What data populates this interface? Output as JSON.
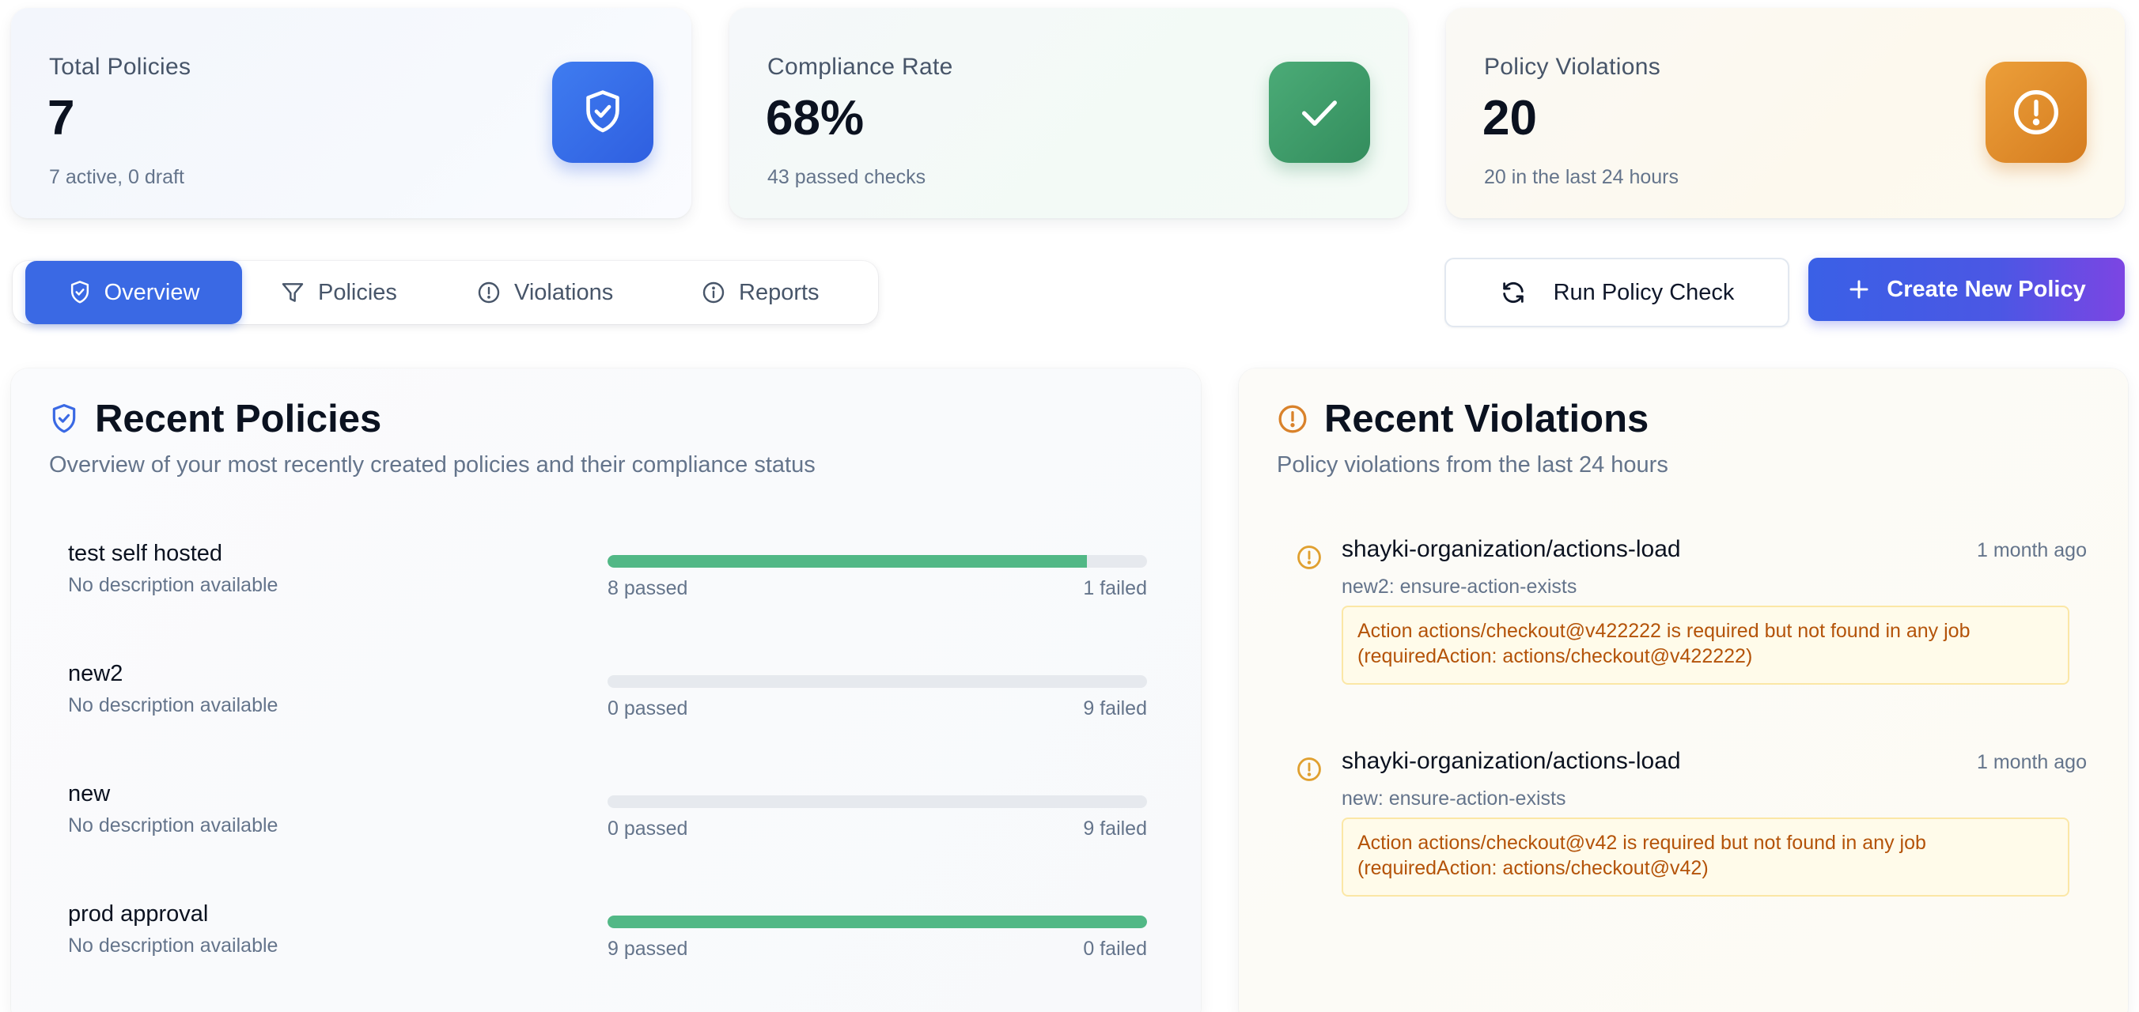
{
  "stats": {
    "total_policies": {
      "title": "Total Policies",
      "value": "7",
      "sub": "7 active, 0 draft",
      "icon": "shield-check-icon",
      "color": "#3a69e4"
    },
    "compliance_rate": {
      "title": "Compliance Rate",
      "value": "68%",
      "sub": "43 passed checks",
      "icon": "check-icon",
      "color": "#3f9d6a"
    },
    "policy_violations": {
      "title": "Policy Violations",
      "value": "20",
      "sub": "20 in the last 24 hours",
      "icon": "alert-circle-icon",
      "color": "#e08a2b"
    }
  },
  "tabs": [
    {
      "label": "Overview",
      "icon": "shield-check-icon",
      "active": true
    },
    {
      "label": "Policies",
      "icon": "filter-icon",
      "active": false
    },
    {
      "label": "Violations",
      "icon": "alert-circle-icon",
      "active": false
    },
    {
      "label": "Reports",
      "icon": "info-icon",
      "active": false
    }
  ],
  "actions": {
    "run_check": {
      "label": "Run Policy Check",
      "icon": "refresh-icon"
    },
    "create_policy": {
      "label": "Create New Policy",
      "icon": "plus-icon"
    }
  },
  "recent_policies": {
    "title": "Recent Policies",
    "description": "Overview of your most recently created policies and their compliance status",
    "items": [
      {
        "name": "test self hosted",
        "description": "No description available",
        "passed_label": "8 passed",
        "failed_label": "1 failed",
        "passed": 8,
        "failed": 1
      },
      {
        "name": "new2",
        "description": "No description available",
        "passed_label": "0 passed",
        "failed_label": "9 failed",
        "passed": 0,
        "failed": 9
      },
      {
        "name": "new",
        "description": "No description available",
        "passed_label": "0 passed",
        "failed_label": "9 failed",
        "passed": 0,
        "failed": 9
      },
      {
        "name": "prod approval",
        "description": "No description available",
        "passed_label": "9 passed",
        "failed_label": "0 failed",
        "passed": 9,
        "failed": 0
      }
    ]
  },
  "recent_violations": {
    "title": "Recent Violations",
    "description": "Policy violations from the last 24 hours",
    "items": [
      {
        "repo": "shayki-organization/actions-load",
        "time": "1 month ago",
        "rule": "new2: ensure-action-exists",
        "message_line1": "Action actions/checkout@v422222 is required but not found in any job",
        "message_line2": "(requiredAction: actions/checkout@v422222)"
      },
      {
        "repo": "shayki-organization/actions-load",
        "time": "1 month ago",
        "rule": "new: ensure-action-exists",
        "message_line1": "Action actions/checkout@v42 is required but not found in any job",
        "message_line2": "(requiredAction: actions/checkout@v42)"
      }
    ]
  }
}
